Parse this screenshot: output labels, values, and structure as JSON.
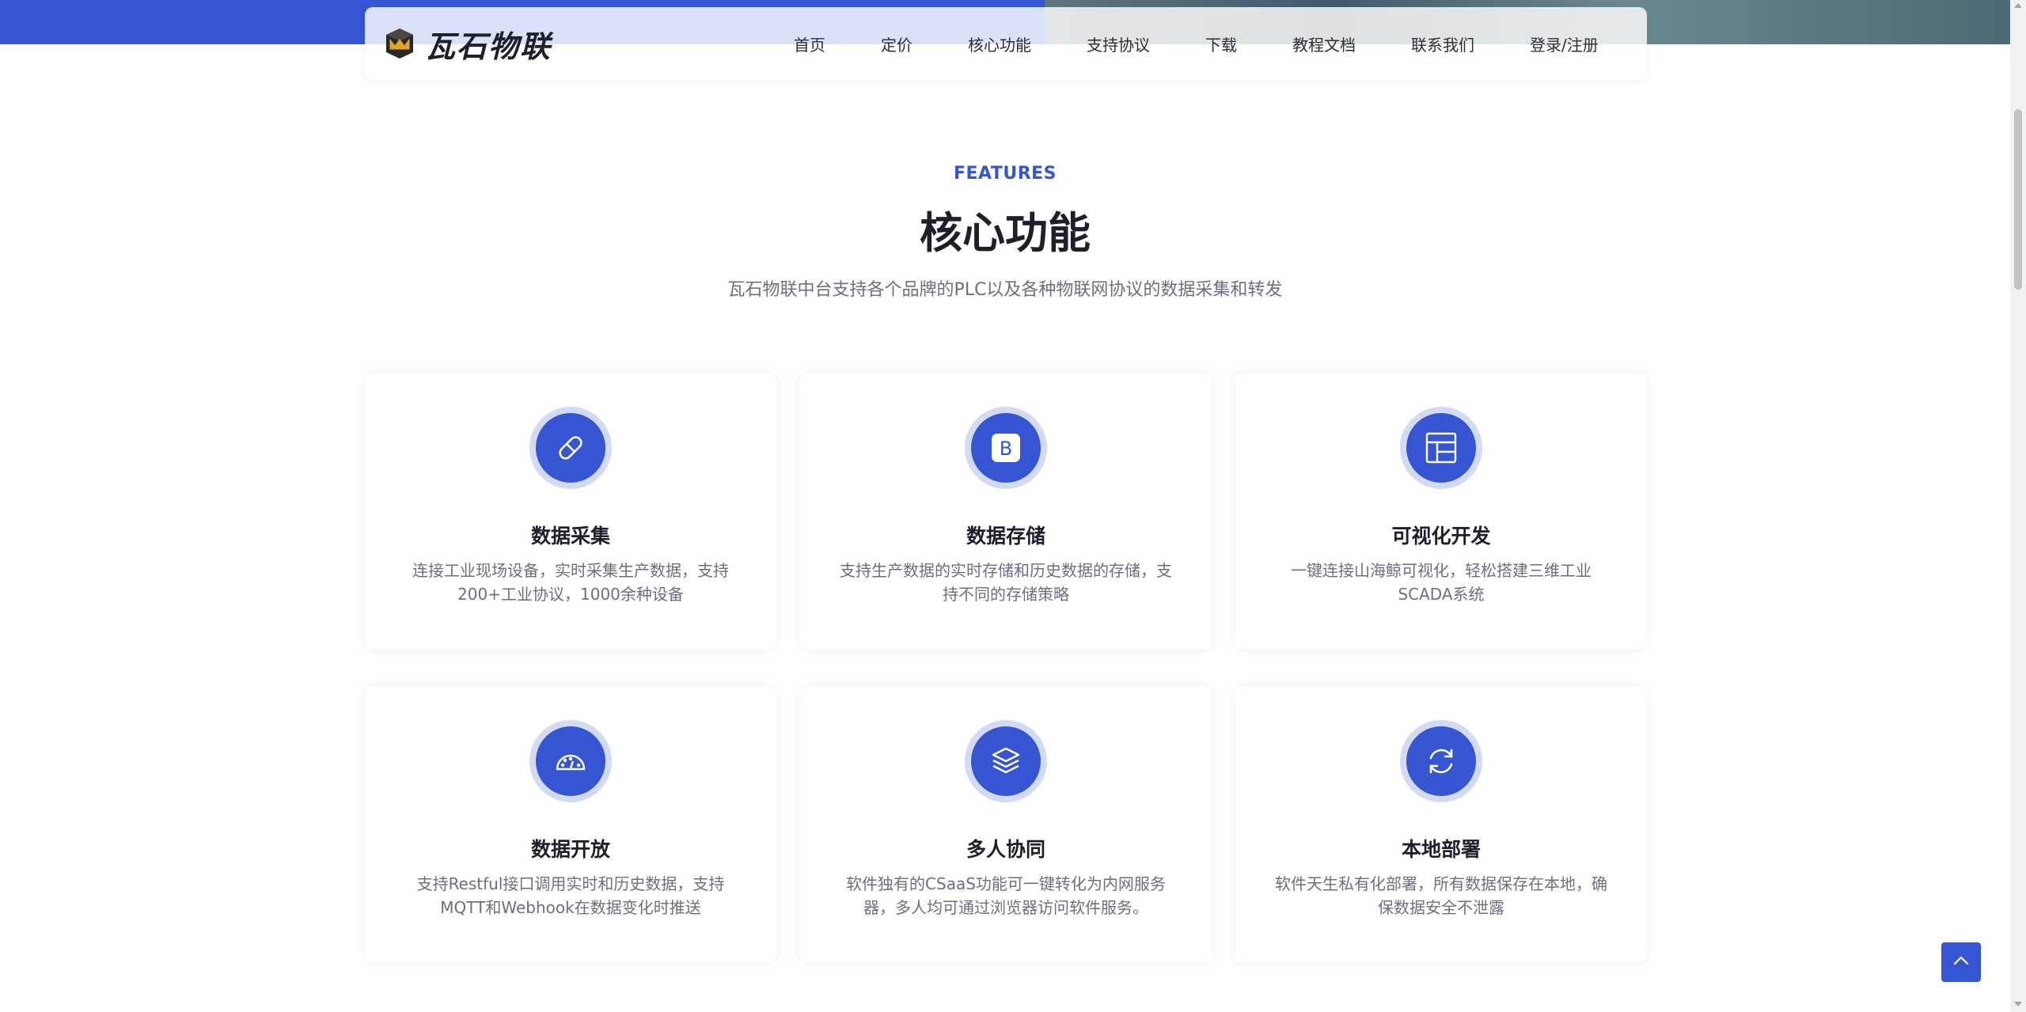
{
  "brand": {
    "name": "瓦石物联",
    "accent_color": "#3555d2",
    "logo_icon": "crown-cube-icon"
  },
  "nav": {
    "items": [
      {
        "label": "首页"
      },
      {
        "label": "定价"
      },
      {
        "label": "核心功能"
      },
      {
        "label": "支持协议"
      },
      {
        "label": "下载"
      },
      {
        "label": "教程文档"
      },
      {
        "label": "联系我们"
      },
      {
        "label": "登录/注册"
      }
    ]
  },
  "features": {
    "eyebrow": "FEATURES",
    "title": "核心功能",
    "subtitle": "瓦石物联中台支持各个品牌的PLC以及各种物联网协议的数据采集和转发",
    "cards": [
      {
        "icon": "capsule-icon",
        "title": "数据采集",
        "description": "连接工业现场设备，实时采集生产数据，支持200+工业协议，1000余种设备"
      },
      {
        "icon": "bootstrap-b-icon",
        "title": "数据存储",
        "description": "支持生产数据的实时存储和历史数据的存储，支持不同的存储策略"
      },
      {
        "icon": "layout-grid-icon",
        "title": "可视化开发",
        "description": "一键连接山海鲸可视化，轻松搭建三维工业SCADA系统"
      },
      {
        "icon": "speedometer-icon",
        "title": "数据开放",
        "description": "支持Restful接口调用实时和历史数据，支持MQTT和Webhook在数据变化时推送"
      },
      {
        "icon": "layers-icon",
        "title": "多人协同",
        "description": "软件独有的CSaaS功能可一键转化为内网服务器，多人均可通过浏览器访问软件服务。"
      },
      {
        "icon": "refresh-icon",
        "title": "本地部署",
        "description": "软件天生私有化部署，所有数据保存在本地，确保数据安全不泄露"
      }
    ]
  },
  "back_to_top": {
    "icon": "chevron-up-icon"
  }
}
